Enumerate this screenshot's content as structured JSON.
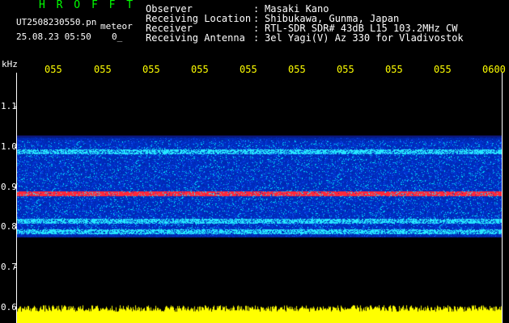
{
  "header": {
    "title": "H R O F F T",
    "title_color": "#00ff00",
    "filename": "UT2508230550.pn",
    "meteor_label": "meteor",
    "datetime": "25.08.23 05:50",
    "index_text": "0_"
  },
  "info": [
    {
      "label": "Observer",
      "value": "Masaki Kano"
    },
    {
      "label": "Receiving Location",
      "value": "Shibukawa, Gunma, Japan"
    },
    {
      "label": "Receiver",
      "value": "RTL-SDR SDR# 43dB L15 103.2MHz CW"
    },
    {
      "label": "Receiving Antenna",
      "value": "3el Yagi(V) Az 330 for Vladivostok"
    }
  ],
  "separator": ":",
  "axis": {
    "unit_label": "kHz",
    "x_ticks": [
      "055",
      "055",
      "055",
      "055",
      "055",
      "055",
      "055",
      "055",
      "055",
      "0600"
    ],
    "y_ticks": [
      "1.1",
      "1.0",
      "0.9",
      "0.8",
      "0.7",
      "0.6"
    ],
    "label_color": "#ffff00"
  },
  "chart_data": {
    "type": "heatmap",
    "xlabel": "",
    "ylabel": "kHz",
    "y_ticks": [
      1.1,
      1.0,
      0.9,
      0.8,
      0.7,
      0.6
    ],
    "signal_band_khz": [
      0.775,
      1.025
    ],
    "strong_lines_khz": [
      0.885,
      0.988,
      0.815,
      0.79
    ],
    "colors": {
      "noise": "#0022cc",
      "mid": "#00ffff",
      "peak": "#ff2040",
      "power": "#ffff00"
    }
  }
}
